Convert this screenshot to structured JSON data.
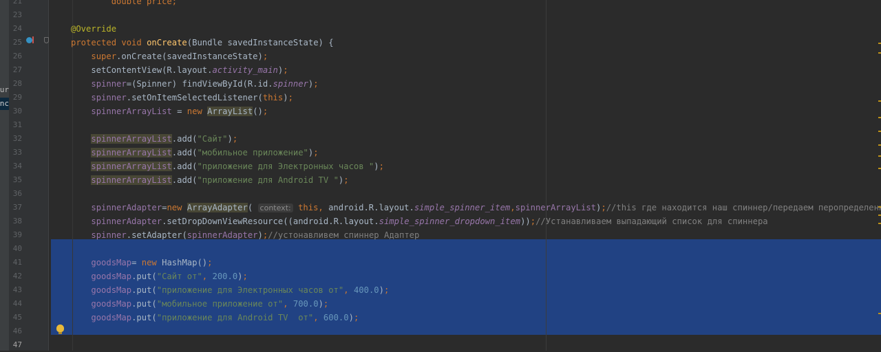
{
  "colors": {
    "background": "#2b2b2b",
    "selection": "#214283",
    "keyword": "#cc7832",
    "string": "#6a8759",
    "number": "#6897bb",
    "field": "#9876aa",
    "method_decl": "#ffc66d",
    "annotation": "#bbb529",
    "comment": "#808080"
  },
  "side_panel": {
    "item_1": "our",
    "item_2": "unc"
  },
  "editor": {
    "lines": [
      {
        "n": "21",
        "parts": [
          {
            "c": "kw",
            "t": "        double price;"
          }
        ]
      },
      {
        "n": "23",
        "parts": []
      },
      {
        "n": "24",
        "parts": [
          {
            "c": "ann",
            "t": "@Override"
          }
        ]
      },
      {
        "n": "25",
        "parts": [
          {
            "c": "kw",
            "t": "protected void "
          },
          {
            "c": "fn",
            "t": "onCreate"
          },
          {
            "c": "",
            "t": "(Bundle savedInstanceState) {"
          }
        ]
      },
      {
        "n": "26",
        "parts": [
          {
            "c": "",
            "t": "    "
          },
          {
            "c": "kw",
            "t": "super"
          },
          {
            "c": "",
            "t": ".onCreate(savedInstanceState)"
          },
          {
            "c": "kw",
            "t": ";"
          }
        ]
      },
      {
        "n": "27",
        "parts": [
          {
            "c": "",
            "t": "    setContentView(R.layout."
          },
          {
            "c": "ifld",
            "t": "activity_main"
          },
          {
            "c": "",
            "t": ")"
          },
          {
            "c": "kw",
            "t": ";"
          }
        ]
      },
      {
        "n": "28",
        "parts": [
          {
            "c": "",
            "t": "    "
          },
          {
            "c": "fld",
            "t": "spinner"
          },
          {
            "c": "",
            "t": "=(Spinner) findViewById(R.id."
          },
          {
            "c": "ifld",
            "t": "spinner"
          },
          {
            "c": "",
            "t": ")"
          },
          {
            "c": "kw",
            "t": ";"
          }
        ]
      },
      {
        "n": "29",
        "parts": [
          {
            "c": "",
            "t": "    "
          },
          {
            "c": "fld",
            "t": "spinner"
          },
          {
            "c": "",
            "t": ".setOnItemSelectedListener("
          },
          {
            "c": "kw",
            "t": "this"
          },
          {
            "c": "",
            "t": ")"
          },
          {
            "c": "kw",
            "t": ";"
          }
        ]
      },
      {
        "n": "30",
        "parts": [
          {
            "c": "",
            "t": "    "
          },
          {
            "c": "fld",
            "t": "spinnerArrayList"
          },
          {
            "c": "",
            "t": " = "
          },
          {
            "c": "kw",
            "t": "new "
          },
          {
            "c": "hl",
            "t": "ArrayList"
          },
          {
            "c": "",
            "t": "()"
          },
          {
            "c": "kw",
            "t": ";"
          }
        ]
      },
      {
        "n": "31",
        "parts": []
      },
      {
        "n": "32",
        "parts": [
          {
            "c": "",
            "t": "    "
          },
          {
            "c": "hl2 fld",
            "t": "spinnerArrayList"
          },
          {
            "c": "",
            "t": ".add("
          },
          {
            "c": "str",
            "t": "\"Сайт\""
          },
          {
            "c": "",
            "t": ")"
          },
          {
            "c": "kw",
            "t": ";"
          }
        ]
      },
      {
        "n": "33",
        "parts": [
          {
            "c": "",
            "t": "    "
          },
          {
            "c": "hl2 fld",
            "t": "spinnerArrayList"
          },
          {
            "c": "",
            "t": ".add("
          },
          {
            "c": "str",
            "t": "\"мобильное приложение\""
          },
          {
            "c": "",
            "t": ")"
          },
          {
            "c": "kw",
            "t": ";"
          }
        ]
      },
      {
        "n": "34",
        "parts": [
          {
            "c": "",
            "t": "    "
          },
          {
            "c": "hl2 fld",
            "t": "spinnerArrayList"
          },
          {
            "c": "",
            "t": ".add("
          },
          {
            "c": "str",
            "t": "\"приложение для Электронных часов \""
          },
          {
            "c": "",
            "t": ")"
          },
          {
            "c": "kw",
            "t": ";"
          }
        ]
      },
      {
        "n": "35",
        "parts": [
          {
            "c": "",
            "t": "    "
          },
          {
            "c": "hl2 fld",
            "t": "spinnerArrayList"
          },
          {
            "c": "",
            "t": ".add("
          },
          {
            "c": "str",
            "t": "\"приложение для Android TV \""
          },
          {
            "c": "",
            "t": ")"
          },
          {
            "c": "kw",
            "t": ";"
          }
        ]
      },
      {
        "n": "36",
        "parts": []
      },
      {
        "n": "37",
        "parts": [
          {
            "c": "",
            "t": "    "
          },
          {
            "c": "fld",
            "t": "spinnerAdapter"
          },
          {
            "c": "",
            "t": "="
          },
          {
            "c": "kw",
            "t": "new "
          },
          {
            "c": "hl",
            "t": "ArrayAdapter"
          },
          {
            "c": "",
            "t": "( "
          },
          {
            "c": "hint",
            "t": "context:"
          },
          {
            "c": "",
            "t": " "
          },
          {
            "c": "kw",
            "t": "this, "
          },
          {
            "c": "",
            "t": "android.R.layout."
          },
          {
            "c": "ifld",
            "t": "simple_spinner_item"
          },
          {
            "c": "kw",
            "t": ","
          },
          {
            "c": "fld",
            "t": "spinnerArrayList"
          },
          {
            "c": "",
            "t": ")"
          },
          {
            "c": "kw",
            "t": ";"
          },
          {
            "c": "cmt",
            "t": "//this где находится наш спиннер/передаем перопределенный а"
          }
        ]
      },
      {
        "n": "38",
        "parts": [
          {
            "c": "",
            "t": "    "
          },
          {
            "c": "fld",
            "t": "spinnerAdapter"
          },
          {
            "c": "",
            "t": ".setDropDownViewResource((android.R.layout."
          },
          {
            "c": "ifld",
            "t": "simple_spinner_dropdown_item"
          },
          {
            "c": "",
            "t": "))"
          },
          {
            "c": "kw",
            "t": ";"
          },
          {
            "c": "cmt",
            "t": "//Устанавливаем выпадающий список для спиннера"
          }
        ]
      },
      {
        "n": "39",
        "parts": [
          {
            "c": "",
            "t": "    "
          },
          {
            "c": "fld",
            "t": "spinner"
          },
          {
            "c": "",
            "t": ".setAdapter("
          },
          {
            "c": "fld",
            "t": "spinnerAdapter"
          },
          {
            "c": "",
            "t": ")"
          },
          {
            "c": "kw",
            "t": ";"
          },
          {
            "c": "cmt",
            "t": "//устонавливем спиннер Адаптер"
          }
        ]
      },
      {
        "n": "40",
        "parts": []
      },
      {
        "n": "41",
        "parts": [
          {
            "c": "",
            "t": "    "
          },
          {
            "c": "fld",
            "t": "goodsMap"
          },
          {
            "c": "",
            "t": "= "
          },
          {
            "c": "kw",
            "t": "new "
          },
          {
            "c": "",
            "t": "HashMap()"
          },
          {
            "c": "kw",
            "t": ";"
          }
        ]
      },
      {
        "n": "42",
        "parts": [
          {
            "c": "",
            "t": "    "
          },
          {
            "c": "fld",
            "t": "goodsMap"
          },
          {
            "c": "",
            "t": ".put("
          },
          {
            "c": "str",
            "t": "\"Сайт от\""
          },
          {
            "c": "kw",
            "t": ", "
          },
          {
            "c": "num",
            "t": "200.0"
          },
          {
            "c": "",
            "t": ")"
          },
          {
            "c": "kw",
            "t": ";"
          }
        ]
      },
      {
        "n": "43",
        "parts": [
          {
            "c": "",
            "t": "    "
          },
          {
            "c": "fld",
            "t": "goodsMap"
          },
          {
            "c": "",
            "t": ".put("
          },
          {
            "c": "str",
            "t": "\"приложение для Электронных часов от\""
          },
          {
            "c": "kw",
            "t": ", "
          },
          {
            "c": "num",
            "t": "400.0"
          },
          {
            "c": "",
            "t": ")"
          },
          {
            "c": "kw",
            "t": ";"
          }
        ]
      },
      {
        "n": "44",
        "parts": [
          {
            "c": "",
            "t": "    "
          },
          {
            "c": "fld",
            "t": "goodsMap"
          },
          {
            "c": "",
            "t": ".put("
          },
          {
            "c": "str",
            "t": "\"мобильное приложение от\""
          },
          {
            "c": "kw",
            "t": ", "
          },
          {
            "c": "num",
            "t": "700.0"
          },
          {
            "c": "",
            "t": ")"
          },
          {
            "c": "kw",
            "t": ";"
          }
        ]
      },
      {
        "n": "45",
        "parts": [
          {
            "c": "",
            "t": "    "
          },
          {
            "c": "fld",
            "t": "goodsMap"
          },
          {
            "c": "",
            "t": ".put("
          },
          {
            "c": "str",
            "t": "\"приложение для Android TV  от\""
          },
          {
            "c": "kw",
            "t": ", "
          },
          {
            "c": "num",
            "t": "600.0"
          },
          {
            "c": "",
            "t": ")"
          },
          {
            "c": "kw",
            "t": ";"
          }
        ]
      },
      {
        "n": "46",
        "parts": []
      },
      {
        "n": "47",
        "parts": [],
        "current": true
      }
    ]
  }
}
